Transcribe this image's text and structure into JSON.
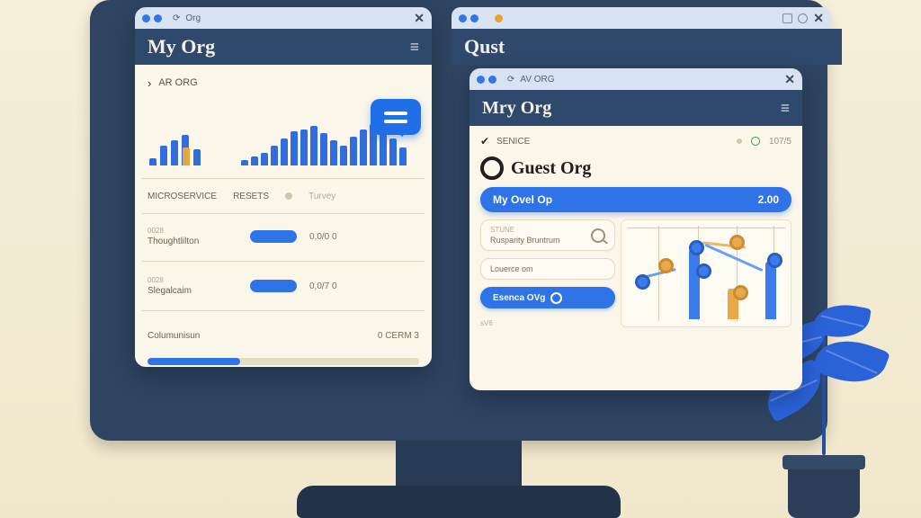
{
  "left_window": {
    "tabstrip": {
      "tab_label": "Org",
      "close_glyph": "✕"
    },
    "title": "My Org",
    "status_label": "AR ORG",
    "caret_glyph": "›",
    "tabs": {
      "a": "MICROSERVICE",
      "b": "RESETS",
      "c": "Turvey"
    },
    "rows": [
      {
        "tiny": "0028",
        "label": "Thoughtlilton",
        "value": "0,0/0 0"
      },
      {
        "tiny": "0028",
        "label": "Slegalcaim",
        "value": "0,0/7 0"
      },
      {
        "tiny": "",
        "label": "Columunisun",
        "value": "0 CERM 3"
      }
    ]
  },
  "outer_right": {
    "tab_label": "Qust",
    "close_glyph": "✕"
  },
  "right_window": {
    "tabstrip": {
      "tab_label": "AV ORG",
      "close_glyph": "✕"
    },
    "title": "Mry Org",
    "status": {
      "label": "SENICE",
      "score": "107/5"
    },
    "heading": "Guest Org",
    "bluebar": {
      "label": "My Ovel Op",
      "value": "2.00"
    },
    "left": {
      "card1": {
        "tiny": "STUNE",
        "text": "Rusparity Bruntrum"
      },
      "card2": {
        "text": "Louerce om"
      },
      "button": "Esenca OVg",
      "tiny_below": "sV6"
    }
  },
  "chart_data": [
    {
      "type": "bar",
      "title": "left-mini-bars-a",
      "categories": [
        "1",
        "2",
        "3",
        "4",
        "5"
      ],
      "series": [
        {
          "name": "primary",
          "values": [
            8,
            22,
            28,
            34,
            18
          ],
          "color": "#316ddd"
        },
        {
          "name": "accent",
          "values": [
            0,
            0,
            0,
            20,
            0
          ],
          "color": "#e7a740"
        }
      ],
      "ylim": [
        0,
        40
      ]
    },
    {
      "type": "bar",
      "title": "left-mini-bars-b",
      "categories": [
        "1",
        "2",
        "3",
        "4",
        "5",
        "6",
        "7",
        "8",
        "9",
        "10",
        "11",
        "12",
        "13",
        "14",
        "15",
        "16",
        "17"
      ],
      "values": [
        6,
        10,
        14,
        22,
        30,
        38,
        40,
        44,
        36,
        28,
        22,
        32,
        40,
        46,
        38,
        30,
        20
      ],
      "ylim": [
        0,
        50
      ],
      "color": "#316ddd"
    },
    {
      "type": "scatter",
      "title": "right-network-chart",
      "series": [
        {
          "name": "blue",
          "points": [
            [
              1,
              2.2
            ],
            [
              2,
              3.0
            ],
            [
              3,
              2.6
            ],
            [
              4,
              1.3
            ]
          ],
          "color": "#3b7bea"
        },
        {
          "name": "orange",
          "points": [
            [
              1.5,
              2.6
            ],
            [
              3,
              3.2
            ],
            [
              3.4,
              1.6
            ]
          ],
          "color": "#e9a84a"
        }
      ],
      "xlim": [
        0,
        5
      ],
      "ylim": [
        0,
        4
      ],
      "bars": [
        {
          "x": 2,
          "h": 2.8,
          "color": "#3b7bea"
        },
        {
          "x": 3,
          "h": 1.2,
          "color": "#e9a84a"
        },
        {
          "x": 4,
          "h": 2.3,
          "color": "#3b7bea"
        }
      ]
    }
  ],
  "colors": {
    "accent": "#2f74e6",
    "panel": "#faf6ea",
    "frame": "#2f496c"
  }
}
